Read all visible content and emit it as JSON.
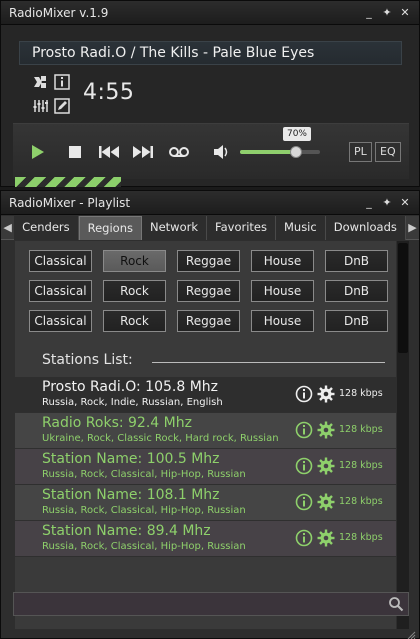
{
  "player": {
    "title": "RadioMixer  v.1.9",
    "now_playing": "Prosto Radi.O / The Kills - Pale Blue Eyes",
    "time": "4:55",
    "volume_label": "70%",
    "volume_level": 0.7,
    "pl_label": "PL",
    "eq_label": "EQ",
    "window_buttons": [
      "_",
      "pin",
      "x"
    ]
  },
  "playlist": {
    "title": "RadioMixer - Playlist",
    "tabs": [
      "Cenders",
      "Regions",
      "Network",
      "Favorites",
      "Music",
      "Downloads"
    ],
    "active_tab": "Regions",
    "genre_rows": [
      [
        "Classical",
        "Rock",
        "Reggae",
        "House",
        "DnB"
      ],
      [
        "Classical",
        "Rock",
        "Reggae",
        "House",
        "DnB"
      ],
      [
        "Classical",
        "Rock",
        "Reggae",
        "House",
        "DnB"
      ]
    ],
    "stations_label": "Stations List:",
    "stations": [
      {
        "name": "Prosto Radi.O: 105.8 Mhz",
        "tags": "Russia, Rock, Indie, Russian, English",
        "bitrate": "128 kbps"
      },
      {
        "name": "Radio Roks: 92.4 Mhz",
        "tags": "Ukraine, Rock, Classic Rock, Hard rock, Russian",
        "bitrate": "128 kbps"
      },
      {
        "name": "Station Name: 100.5 Mhz",
        "tags": "Russia, Rock, Classical, Hip-Hop, Russian",
        "bitrate": "128 kbps"
      },
      {
        "name": "Station Name: 108.1 Mhz",
        "tags": "Russia, Rock, Classical, Hip-Hop, Russian",
        "bitrate": "128 kbps"
      },
      {
        "name": "Station Name: 89.4 Mhz",
        "tags": "Russia, Rock, Classical, Hip-Hop, Russian",
        "bitrate": "128 kbps"
      }
    ],
    "search_value": ""
  },
  "colors": {
    "accent_green": "#8ed06b"
  }
}
